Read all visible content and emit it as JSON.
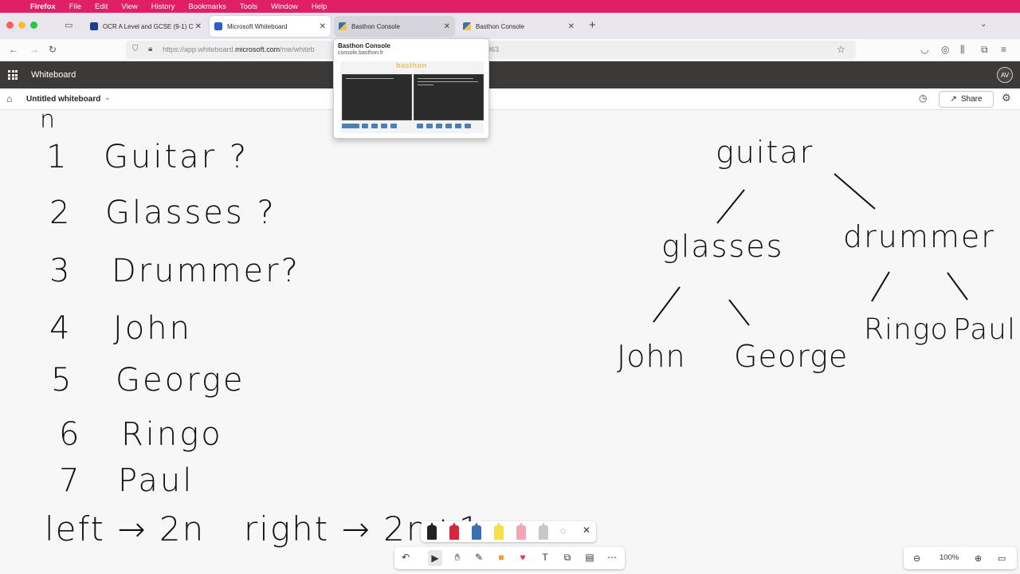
{
  "menubar": {
    "app": "Firefox",
    "items": [
      "File",
      "Edit",
      "View",
      "History",
      "Bookmarks",
      "Tools",
      "Window",
      "Help"
    ]
  },
  "tabs": [
    {
      "label": "OCR A Level and GCSE (9-1) C",
      "state": "normal"
    },
    {
      "label": "Microsoft Whiteboard",
      "state": "active"
    },
    {
      "label": "Basthon Console",
      "state": "hover"
    },
    {
      "label": "Basthon Console",
      "state": "normal"
    }
  ],
  "nav": {
    "url_prefix": "https://app.whiteboard.",
    "url_domain": "microsoft.com",
    "url_rest": "/me/whiteb",
    "url_tail": "963"
  },
  "tab_preview": {
    "title": "Basthon Console",
    "url": "console.basthon.fr",
    "logo": "basthon"
  },
  "whiteboard": {
    "app_title": "Whiteboard",
    "avatar": "AV",
    "board_name": "Untitled whiteboard",
    "share_label": "Share",
    "zoom": "100%"
  },
  "ink": {
    "list": [
      {
        "n": "1",
        "word": "Guitar ?"
      },
      {
        "n": "2",
        "word": "Glasses ?"
      },
      {
        "n": "3",
        "word": "Drummer?"
      },
      {
        "n": "4",
        "word": "John"
      },
      {
        "n": "5",
        "word": "George"
      },
      {
        "n": "6",
        "word": "Ringo"
      },
      {
        "n": "7",
        "word": "Paul"
      }
    ],
    "top_letter": "n",
    "rule_left": "left → 2n",
    "rule_right": "right → 2n+1",
    "tree": {
      "root": "guitar",
      "left": "glasses",
      "right": "drummer",
      "leaves": [
        "John",
        "George",
        "Ringo",
        "Paul"
      ]
    }
  },
  "colors": {
    "menubar": "#e01f66",
    "header": "#3b3a39",
    "ink": "#111111"
  },
  "icons": {
    "pens": [
      "black-pen-icon",
      "red-pen-icon",
      "blue-pen-icon",
      "yellow-highlighter-icon",
      "pink-pen-icon",
      "ruler-icon"
    ],
    "tools": [
      "undo-icon",
      "select-icon",
      "hand-icon",
      "pen-icon",
      "sticky-note-icon",
      "reaction-icon",
      "text-icon",
      "shapes-icon",
      "template-icon",
      "more-icon"
    ]
  }
}
